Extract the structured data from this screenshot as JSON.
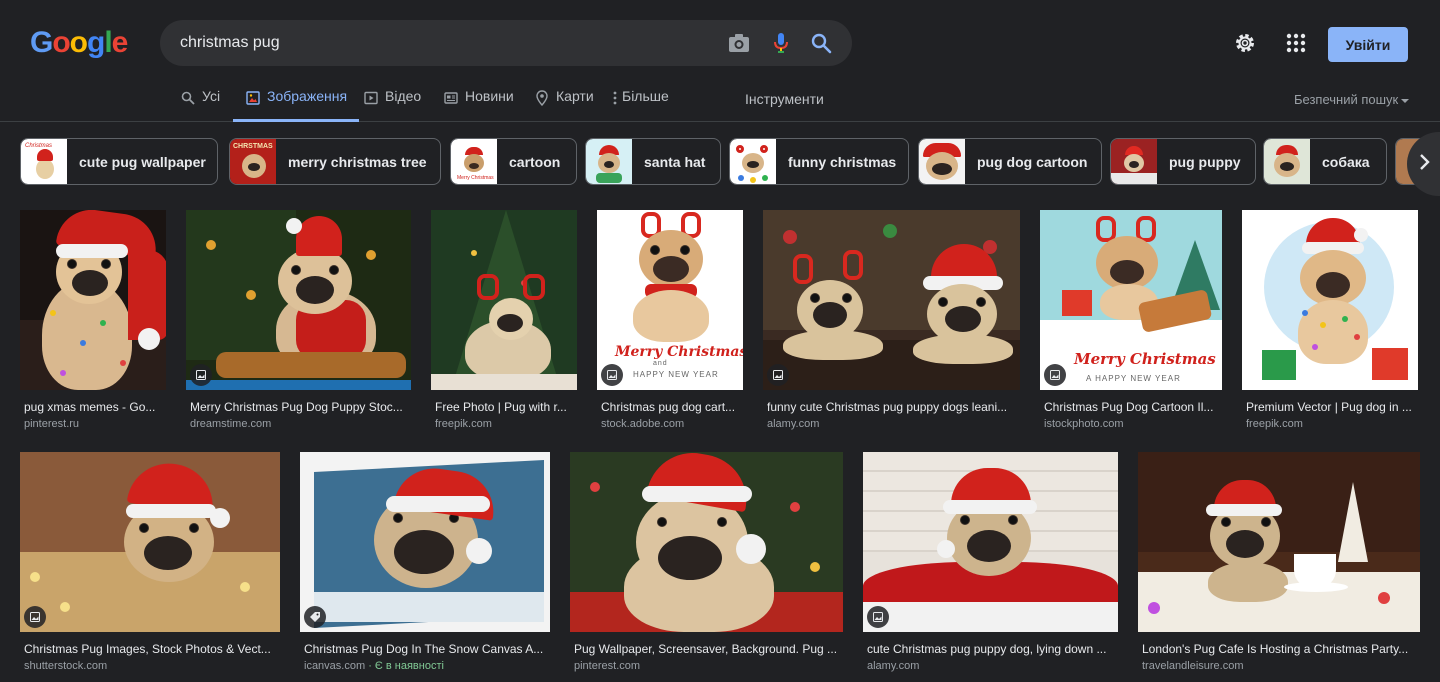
{
  "logo": {
    "letters": [
      "G",
      "o",
      "o",
      "g",
      "l",
      "e"
    ]
  },
  "search": {
    "query": "christmas pug"
  },
  "header": {
    "signin_label": "Увійти"
  },
  "tabs": {
    "all": "Усі",
    "images": "Зображення",
    "videos": "Відео",
    "news": "Новини",
    "maps": "Карти",
    "more": "Більше",
    "tools": "Інструменти",
    "safe_search": "Безпечний пошук"
  },
  "chips": [
    {
      "label": "cute pug wallpaper"
    },
    {
      "label": "merry christmas tree"
    },
    {
      "label": "cartoon"
    },
    {
      "label": "santa hat"
    },
    {
      "label": "funny christmas"
    },
    {
      "label": "pug dog cartoon"
    },
    {
      "label": "pug puppy"
    },
    {
      "label": "собака"
    }
  ],
  "results": [
    {
      "title": "pug xmas memes - Go...",
      "source": "pinterest.ru"
    },
    {
      "title": "Merry Christmas Pug Dog Puppy Stoc...",
      "source": "dreamstime.com"
    },
    {
      "title": "Free Photo | Pug with r...",
      "source": "freepik.com"
    },
    {
      "title": "Christmas pug dog cart...",
      "source": "stock.adobe.com"
    },
    {
      "title": "funny cute Christmas pug puppy dogs leani...",
      "source": "alamy.com"
    },
    {
      "title": "Christmas Pug Dog Cartoon Il...",
      "source": "istockphoto.com"
    },
    {
      "title": "Premium Vector | Pug dog in ...",
      "source": "freepik.com"
    },
    {
      "title": "Christmas Pug Images, Stock Photos & Vect...",
      "source": "shutterstock.com"
    },
    {
      "title": "Christmas Pug Dog In The Snow Canvas A...",
      "source": "icanvas.com",
      "stock": " · Є в наявності"
    },
    {
      "title": "Pug Wallpaper, Screensaver, Background. Pug ...",
      "source": "pinterest.com"
    },
    {
      "title": "cute Christmas pug puppy dog, lying down ...",
      "source": "alamy.com"
    },
    {
      "title": "London's Pug Cafe Is Hosting a Christmas Party...",
      "source": "travelandleisure.com"
    }
  ],
  "image_text": {
    "merry": "Merry Christmas",
    "and": "and",
    "happy_new_year": "HAPPY NEW YEAR",
    "a_happy_new_year": "A HAPPY NEW YEAR"
  },
  "colors": {
    "background": "#202124",
    "accent": "#8ab4f8",
    "search_box": "#303134",
    "in_stock": "#81c995"
  },
  "icons": {
    "camera": "camera-icon",
    "mic": "mic-icon",
    "search": "search-icon",
    "settings": "gear-icon",
    "apps": "apps-grid-icon"
  }
}
